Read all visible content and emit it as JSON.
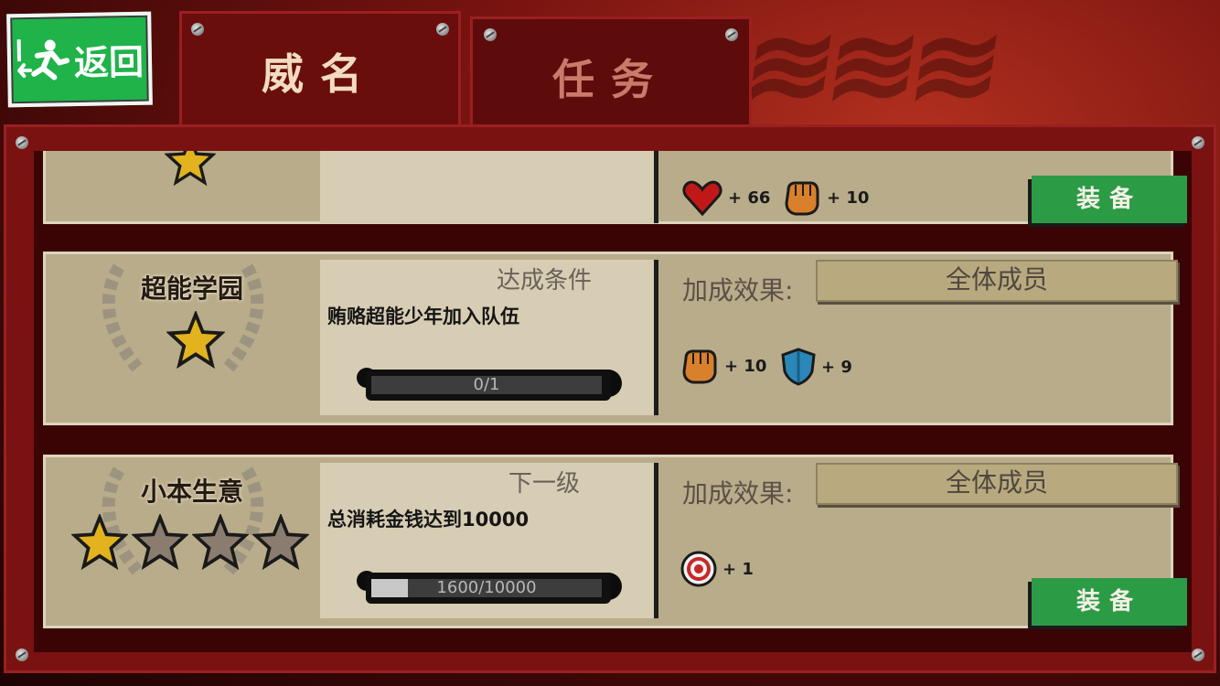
{
  "back_button": {
    "label": "返回",
    "icon": "exit-running-man-icon"
  },
  "tabs": [
    {
      "label": "威名",
      "active": true
    },
    {
      "label": "任务",
      "active": false
    }
  ],
  "cards": [
    {
      "stats": [
        {
          "icon": "heart-icon",
          "value": "+ 66"
        },
        {
          "icon": "fist-icon",
          "value": "+ 10"
        }
      ],
      "equip_label": "装备"
    },
    {
      "name": "超能学园",
      "stars_total": 1,
      "stars_filled": 1,
      "section_title": "达成条件",
      "description": "贿赂超能少年加入队伍",
      "progress_text": "0/1",
      "progress_fraction": 0,
      "bonus_label": "加成效果:",
      "target": "全体成员",
      "stats": [
        {
          "icon": "fist-icon",
          "value": "+ 10"
        },
        {
          "icon": "shield-icon",
          "value": "+ 9"
        }
      ]
    },
    {
      "name": "小本生意",
      "stars_total": 4,
      "stars_filled": 1,
      "section_title": "下一级",
      "description": "总消耗金钱达到10000",
      "progress_text": "1600/10000",
      "progress_fraction": 0.16,
      "bonus_label": "加成效果:",
      "target": "全体成员",
      "stats": [
        {
          "icon": "target-icon",
          "value": "+ 1"
        }
      ],
      "equip_label": "装备"
    }
  ],
  "colors": {
    "frame": "#7a1212",
    "card": "#b9ac8a",
    "equip_button": "#2c9b46",
    "back_button": "#1fb34a"
  }
}
